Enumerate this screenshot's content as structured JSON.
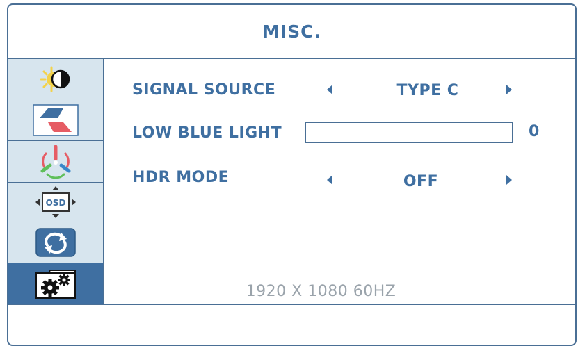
{
  "header": {
    "title": "MISC."
  },
  "sidebar": {
    "items": [
      {
        "icon": "brightness-contrast-icon",
        "active": false
      },
      {
        "icon": "image-settings-icon",
        "active": false
      },
      {
        "icon": "color-rgb-icon",
        "active": false
      },
      {
        "icon": "osd-position-icon",
        "active": false
      },
      {
        "icon": "reset-icon",
        "active": false
      },
      {
        "icon": "misc-settings-gear-icon",
        "active": true
      }
    ]
  },
  "main": {
    "signal_source": {
      "label": "SIGNAL SOURCE",
      "value": "TYPE C"
    },
    "low_blue_light": {
      "label": "LOW BLUE LIGHT",
      "value": "0",
      "level": 0
    },
    "hdr_mode": {
      "label": "HDR MODE",
      "value": "OFF"
    },
    "resolution": "1920 X 1080 60HZ"
  },
  "colors": {
    "accent": "#3f6fa1",
    "sidebar_bg": "#d7e5ee",
    "border": "#4a6f95",
    "muted_text": "#9aa3ab"
  }
}
